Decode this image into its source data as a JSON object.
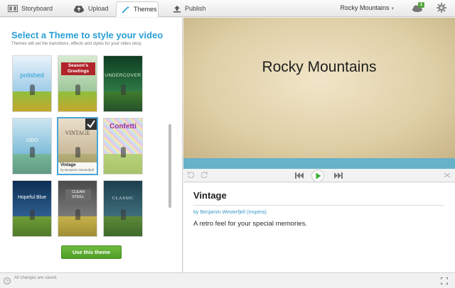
{
  "topbar": {
    "tabs": [
      {
        "label": "Storyboard",
        "icon": "film-icon"
      },
      {
        "label": "Upload",
        "icon": "cloud-upload-icon"
      },
      {
        "label": "Themes",
        "icon": "magic-wand-icon"
      },
      {
        "label": "Publish",
        "icon": "upload-arrow-icon"
      }
    ],
    "active_tab": "Themes",
    "project_title": "Rocky Mountains",
    "project_caret": "▾",
    "notification_count": "1",
    "colors": {
      "accent": "#2a9fd6",
      "badge": "#53a53c"
    }
  },
  "themes_panel": {
    "heading": "Select a Theme to style your video",
    "subheading": "Themes will set the transitions, effects and styles for your video story.",
    "themes": [
      {
        "title": "polished"
      },
      {
        "title": "Season's Greetings"
      },
      {
        "title": "UNDERCOVER"
      },
      {
        "title": "VIDO"
      },
      {
        "title": "VINTAGE",
        "selected": true,
        "name": "Vintage",
        "author": "by Benjamin Westerfjell"
      },
      {
        "title": "Confetti"
      },
      {
        "title": "Hopeful Blue"
      },
      {
        "title": "CLEAN STEEL"
      },
      {
        "title": "CLASSIC"
      }
    ],
    "use_button": "Use this theme"
  },
  "preview": {
    "title": "Rocky Mountains",
    "colors": {
      "band": "#67b1c9"
    }
  },
  "theme_info": {
    "title": "Vintage",
    "author": "by Benjamin Westerfjell (Inspera)",
    "description": "A retro feel for your special memories."
  },
  "status": {
    "text": "All changes are saved."
  }
}
